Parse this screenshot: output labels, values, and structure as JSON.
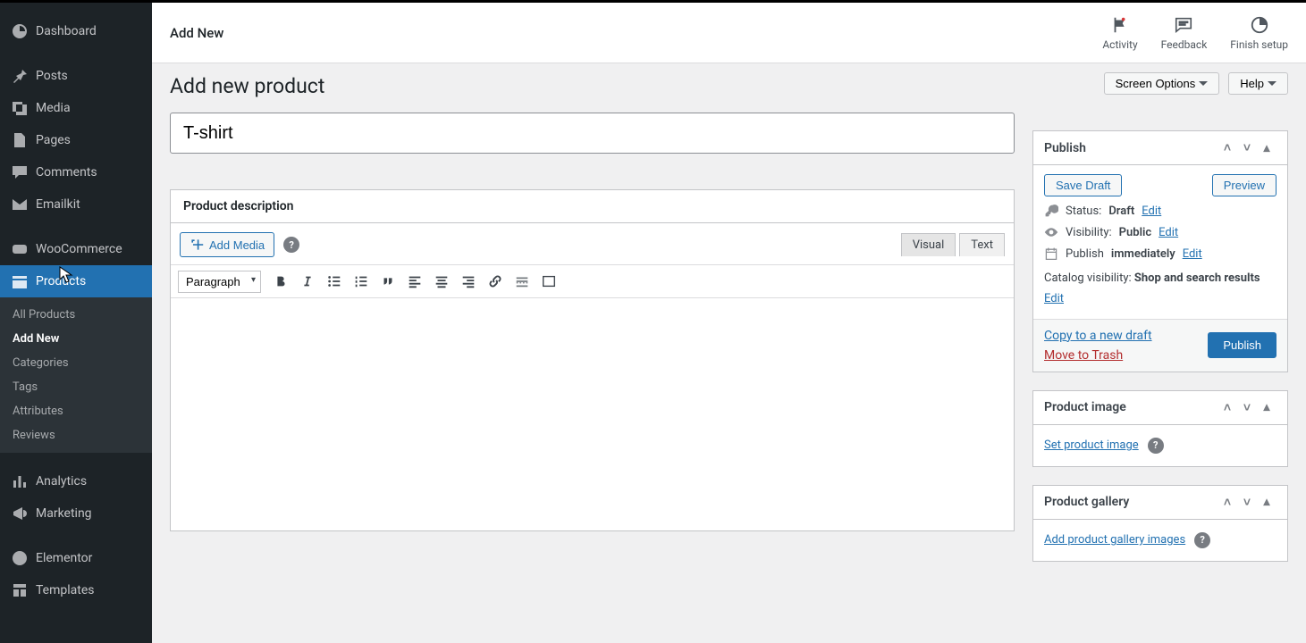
{
  "sidebar": {
    "items": [
      {
        "label": "Dashboard"
      },
      {
        "label": "Posts"
      },
      {
        "label": "Media"
      },
      {
        "label": "Pages"
      },
      {
        "label": "Comments"
      },
      {
        "label": "Emailkit"
      },
      {
        "label": "WooCommerce"
      },
      {
        "label": "Products"
      },
      {
        "label": "Analytics"
      },
      {
        "label": "Marketing"
      },
      {
        "label": "Elementor"
      },
      {
        "label": "Templates"
      }
    ],
    "products_sub": [
      {
        "label": "All Products"
      },
      {
        "label": "Add New"
      },
      {
        "label": "Categories"
      },
      {
        "label": "Tags"
      },
      {
        "label": "Attributes"
      },
      {
        "label": "Reviews"
      }
    ]
  },
  "topbar": {
    "title": "Add New",
    "activity": "Activity",
    "feedback": "Feedback",
    "finish": "Finish setup"
  },
  "screen": {
    "options": "Screen Options",
    "help": "Help"
  },
  "page": {
    "heading": "Add new product",
    "title_value": "T-shirt"
  },
  "editor": {
    "panel_title": "Product description",
    "add_media": "Add Media",
    "tab_visual": "Visual",
    "tab_text": "Text",
    "format": "Paragraph"
  },
  "publish": {
    "title": "Publish",
    "save_draft": "Save Draft",
    "preview": "Preview",
    "status_label": "Status:",
    "status_value": "Draft",
    "visibility_label": "Visibility:",
    "visibility_value": "Public",
    "publish_label": "Publish",
    "publish_value": "immediately",
    "catalog_label": "Catalog visibility:",
    "catalog_value": "Shop and search results",
    "edit": "Edit",
    "copy": "Copy to a new draft",
    "trash": "Move to Trash",
    "publish_btn": "Publish"
  },
  "product_image": {
    "title": "Product image",
    "link": "Set product image"
  },
  "product_gallery": {
    "title": "Product gallery",
    "link": "Add product gallery images"
  }
}
